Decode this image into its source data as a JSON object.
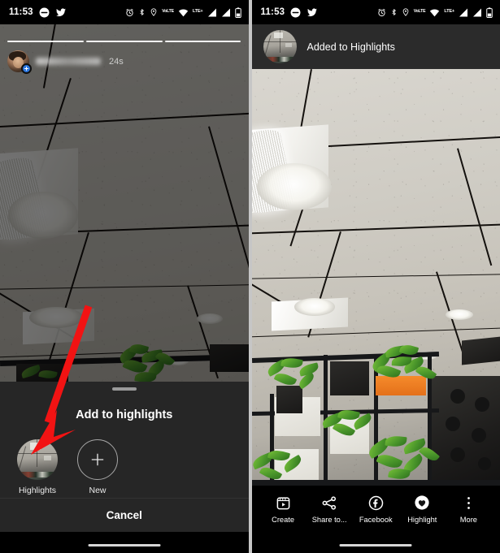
{
  "status_bar": {
    "time": "11:53",
    "left_icons": [
      "messages-icon",
      "twitter-icon"
    ],
    "right_icons": [
      "alarm-icon",
      "bluetooth-icon",
      "location-icon",
      "volte-icon",
      "wifi-icon",
      "lte-plus-icon",
      "signal-sim1-icon",
      "signal-sim2-icon",
      "battery-icon"
    ],
    "volte_label": "VoLTE",
    "lte_label": "LTE+"
  },
  "left_panel": {
    "story": {
      "segments": 3,
      "username_blurred": true,
      "age": "24s",
      "avatar_badge": "add-story-plus-badge"
    },
    "sheet": {
      "title": "Add to highlights",
      "items": [
        {
          "label": "Highlights",
          "type": "existing-highlight"
        },
        {
          "label": "New",
          "type": "create-new"
        }
      ],
      "cancel_label": "Cancel"
    },
    "annotation": {
      "type": "red-arrow",
      "color": "#f21313",
      "points_to": "Highlights"
    }
  },
  "right_panel": {
    "toast": {
      "message": "Added to Highlights",
      "thumbnail": "highlight-cover-thumbnail"
    },
    "actions": [
      {
        "label": "Create",
        "icon": "create-story-icon",
        "active": false
      },
      {
        "label": "Share to...",
        "icon": "share-icon",
        "active": false
      },
      {
        "label": "Facebook",
        "icon": "facebook-icon",
        "active": false
      },
      {
        "label": "Highlight",
        "icon": "highlight-heart-icon",
        "active": true
      },
      {
        "label": "More",
        "icon": "more-vertical-icon",
        "active": false
      }
    ]
  },
  "colors": {
    "sheet_bg": "#262626",
    "toast_bg": "#2b2b2b",
    "accent_red": "#f21313",
    "badge_blue": "#2d78e0",
    "nav_bg": "#000000"
  }
}
